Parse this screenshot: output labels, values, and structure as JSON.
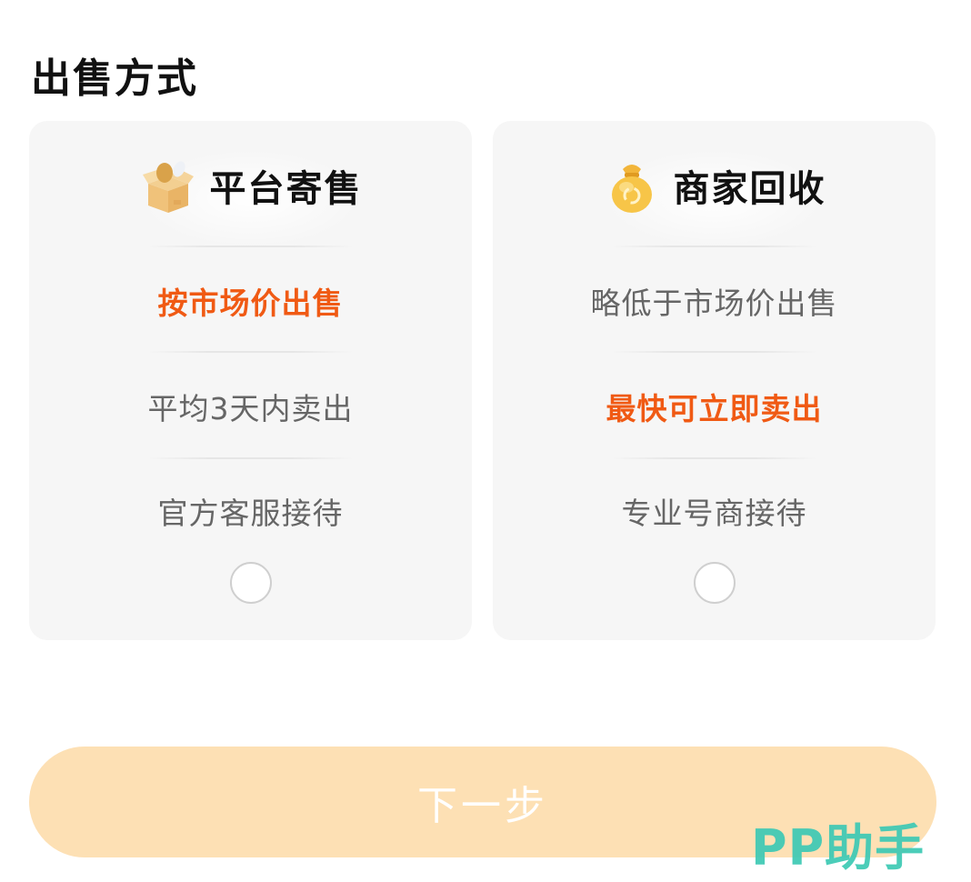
{
  "section_title": "出售方式",
  "options": [
    {
      "title": "平台寄售",
      "icon": "box-icon",
      "features": [
        "按市场价出售",
        "平均3天内卖出",
        "官方客服接待"
      ],
      "highlight_index": 0,
      "selected": false
    },
    {
      "title": "商家回收",
      "icon": "money-bag-icon",
      "features": [
        "略低于市场价出售",
        "最快可立即卖出",
        "专业号商接待"
      ],
      "highlight_index": 1,
      "selected": false
    }
  ],
  "next_button": {
    "label": "下一步"
  },
  "watermark": "PP助手",
  "colors": {
    "accent": "#f05a14",
    "button_bg": "#fde0b4",
    "card_bg": "#f6f6f6",
    "watermark": "#3cc9b4"
  }
}
